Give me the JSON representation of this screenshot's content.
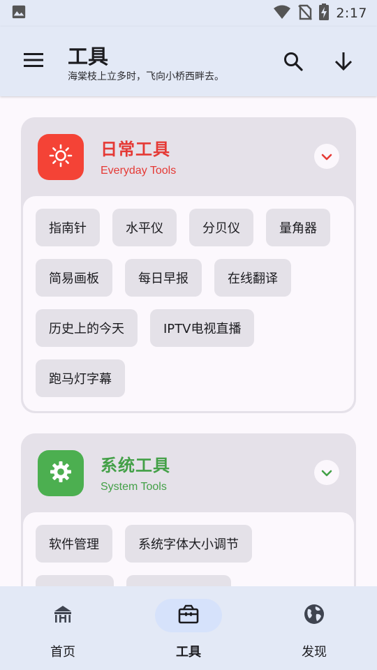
{
  "status_bar": {
    "time": "2:17",
    "icons": [
      "image-icon",
      "wifi-icon",
      "no-sim-icon",
      "battery-charging-icon"
    ]
  },
  "app_bar": {
    "title": "工具",
    "subtitle": "海棠枝上立多时，飞向小桥西畔去。",
    "icons": [
      "menu-icon",
      "search-icon",
      "arrow-down-icon"
    ]
  },
  "sections": [
    {
      "title": "日常工具",
      "subtitle": "Everyday Tools",
      "accent": "#e53935",
      "icon_bg": "#f44336",
      "icon": "sun-icon",
      "expanded": true,
      "tools": [
        "指南针",
        "水平仪",
        "分贝仪",
        "量角器",
        "简易画板",
        "每日早报",
        "在线翻译",
        "历史上的今天",
        "IPTV电视直播",
        "跑马灯字幕"
      ]
    },
    {
      "title": "系统工具",
      "subtitle": "System Tools",
      "accent": "#43a047",
      "icon_bg": "#4caf50",
      "icon": "gear-icon",
      "expanded": true,
      "tools": [
        "软件管理",
        "系统字体大小调节",
        "",
        ""
      ]
    }
  ],
  "bottom_nav": {
    "items": [
      {
        "label": "首页",
        "icon": "home-icon",
        "active": false
      },
      {
        "label": "工具",
        "icon": "toolbox-icon",
        "active": true
      },
      {
        "label": "发现",
        "icon": "globe-icon",
        "active": false
      }
    ]
  }
}
